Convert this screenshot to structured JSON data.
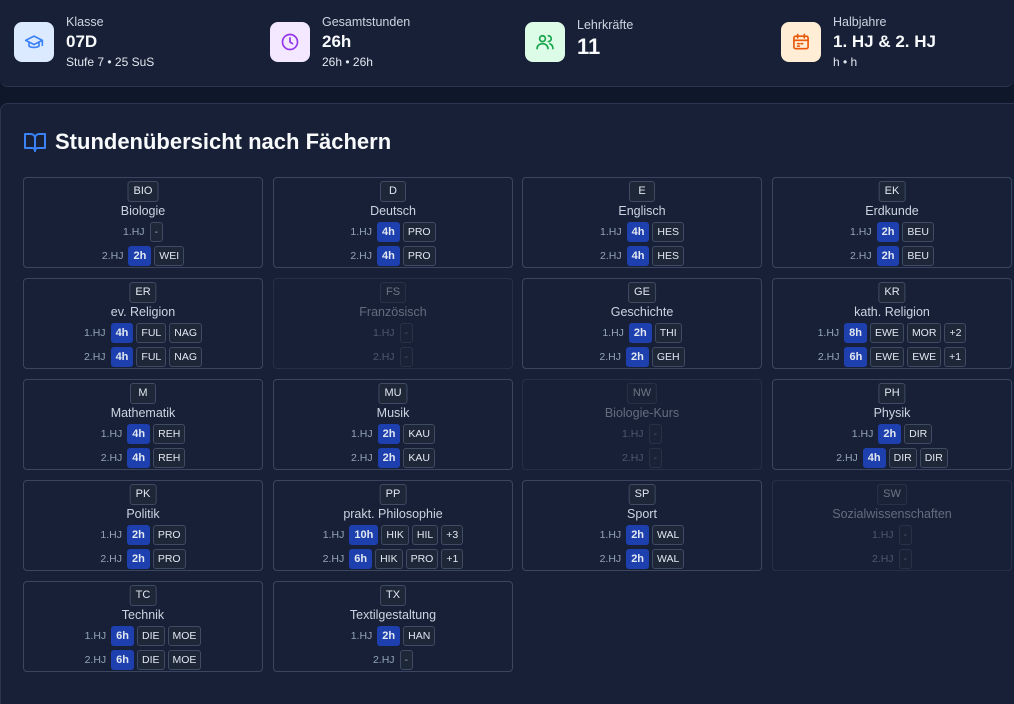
{
  "stats": [
    {
      "label": "Klasse",
      "value": "07D",
      "sub": "Stufe 7 • 25 SuS",
      "icon": "graduation-cap-icon",
      "color": "#3b82f6",
      "bg": "#dbeafe"
    },
    {
      "label": "Gesamtstunden",
      "value": "26h",
      "sub": "26h • 26h",
      "icon": "clock-icon",
      "color": "#9333ea",
      "bg": "#f3e8ff"
    },
    {
      "label": "Lehrkräfte",
      "value": "11",
      "sub": "",
      "icon": "users-icon",
      "color": "#16a34a",
      "bg": "#dcfce7"
    },
    {
      "label": "Halbjahre",
      "value": "1. HJ & 2. HJ",
      "sub": "h • h",
      "icon": "calendar-icon",
      "color": "#ea580c",
      "bg": "#ffedd5"
    }
  ],
  "panel": {
    "title": "Stundenübersicht nach Fächern",
    "icon": "book-open-icon"
  },
  "subjects": [
    {
      "code": "BIO",
      "name": "Biologie",
      "active": true,
      "hj1": {
        "label": "1.HJ",
        "hours": "",
        "teachers": [
          "-"
        ]
      },
      "hj2": {
        "label": "2.HJ",
        "hours": "2h",
        "teachers": [
          "WEI"
        ]
      }
    },
    {
      "code": "D",
      "name": "Deutsch",
      "active": true,
      "hj1": {
        "label": "1.HJ",
        "hours": "4h",
        "teachers": [
          "PRO"
        ]
      },
      "hj2": {
        "label": "2.HJ",
        "hours": "4h",
        "teachers": [
          "PRO"
        ]
      }
    },
    {
      "code": "E",
      "name": "Englisch",
      "active": true,
      "hj1": {
        "label": "1.HJ",
        "hours": "4h",
        "teachers": [
          "HES"
        ]
      },
      "hj2": {
        "label": "2.HJ",
        "hours": "4h",
        "teachers": [
          "HES"
        ]
      }
    },
    {
      "code": "EK",
      "name": "Erdkunde",
      "active": true,
      "hj1": {
        "label": "1.HJ",
        "hours": "2h",
        "teachers": [
          "BEU"
        ]
      },
      "hj2": {
        "label": "2.HJ",
        "hours": "2h",
        "teachers": [
          "BEU"
        ]
      }
    },
    {
      "code": "ER",
      "name": "ev. Religion",
      "active": true,
      "hj1": {
        "label": "1.HJ",
        "hours": "4h",
        "teachers": [
          "FUL",
          "NAG"
        ]
      },
      "hj2": {
        "label": "2.HJ",
        "hours": "4h",
        "teachers": [
          "FUL",
          "NAG"
        ]
      }
    },
    {
      "code": "FS",
      "name": "Französisch",
      "active": false,
      "hj1": {
        "label": "1.HJ",
        "hours": "",
        "teachers": [
          "-"
        ]
      },
      "hj2": {
        "label": "2.HJ",
        "hours": "",
        "teachers": [
          "-"
        ]
      }
    },
    {
      "code": "GE",
      "name": "Geschichte",
      "active": true,
      "hj1": {
        "label": "1.HJ",
        "hours": "2h",
        "teachers": [
          "THI"
        ]
      },
      "hj2": {
        "label": "2.HJ",
        "hours": "2h",
        "teachers": [
          "GEH"
        ]
      }
    },
    {
      "code": "KR",
      "name": "kath. Religion",
      "active": true,
      "hj1": {
        "label": "1.HJ",
        "hours": "8h",
        "teachers": [
          "EWE",
          "MOR",
          "+2"
        ]
      },
      "hj2": {
        "label": "2.HJ",
        "hours": "6h",
        "teachers": [
          "EWE",
          "EWE",
          "+1"
        ]
      }
    },
    {
      "code": "M",
      "name": "Mathematik",
      "active": true,
      "hj1": {
        "label": "1.HJ",
        "hours": "4h",
        "teachers": [
          "REH"
        ]
      },
      "hj2": {
        "label": "2.HJ",
        "hours": "4h",
        "teachers": [
          "REH"
        ]
      }
    },
    {
      "code": "MU",
      "name": "Musik",
      "active": true,
      "hj1": {
        "label": "1.HJ",
        "hours": "2h",
        "teachers": [
          "KAU"
        ]
      },
      "hj2": {
        "label": "2.HJ",
        "hours": "2h",
        "teachers": [
          "KAU"
        ]
      }
    },
    {
      "code": "NW",
      "name": "Biologie-Kurs",
      "active": false,
      "hj1": {
        "label": "1.HJ",
        "hours": "",
        "teachers": [
          "-"
        ]
      },
      "hj2": {
        "label": "2.HJ",
        "hours": "",
        "teachers": [
          "-"
        ]
      }
    },
    {
      "code": "PH",
      "name": "Physik",
      "active": true,
      "hj1": {
        "label": "1.HJ",
        "hours": "2h",
        "teachers": [
          "DIR"
        ]
      },
      "hj2": {
        "label": "2.HJ",
        "hours": "4h",
        "teachers": [
          "DIR",
          "DIR"
        ]
      }
    },
    {
      "code": "PK",
      "name": "Politik",
      "active": true,
      "hj1": {
        "label": "1.HJ",
        "hours": "2h",
        "teachers": [
          "PRO"
        ]
      },
      "hj2": {
        "label": "2.HJ",
        "hours": "2h",
        "teachers": [
          "PRO"
        ]
      }
    },
    {
      "code": "PP",
      "name": "prakt. Philosophie",
      "active": true,
      "hj1": {
        "label": "1.HJ",
        "hours": "10h",
        "teachers": [
          "HIK",
          "HIL",
          "+3"
        ]
      },
      "hj2": {
        "label": "2.HJ",
        "hours": "6h",
        "teachers": [
          "HIK",
          "PRO",
          "+1"
        ]
      }
    },
    {
      "code": "SP",
      "name": "Sport",
      "active": true,
      "hj1": {
        "label": "1.HJ",
        "hours": "2h",
        "teachers": [
          "WAL"
        ]
      },
      "hj2": {
        "label": "2.HJ",
        "hours": "2h",
        "teachers": [
          "WAL"
        ]
      }
    },
    {
      "code": "SW",
      "name": "Sozialwissenschaften",
      "active": false,
      "hj1": {
        "label": "1.HJ",
        "hours": "",
        "teachers": [
          "-"
        ]
      },
      "hj2": {
        "label": "2.HJ",
        "hours": "",
        "teachers": [
          "-"
        ]
      }
    },
    {
      "code": "TC",
      "name": "Technik",
      "active": true,
      "hj1": {
        "label": "1.HJ",
        "hours": "6h",
        "teachers": [
          "DIE",
          "MOE"
        ]
      },
      "hj2": {
        "label": "2.HJ",
        "hours": "6h",
        "teachers": [
          "DIE",
          "MOE"
        ]
      }
    },
    {
      "code": "TX",
      "name": "Textilgestaltung",
      "active": true,
      "hj1": {
        "label": "1.HJ",
        "hours": "2h",
        "teachers": [
          "HAN"
        ]
      },
      "hj2": {
        "label": "2.HJ",
        "hours": "",
        "teachers": [
          "-"
        ]
      }
    }
  ]
}
